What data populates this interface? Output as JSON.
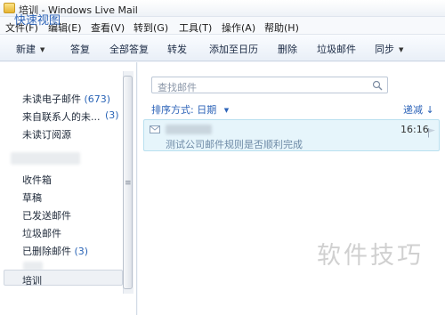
{
  "window": {
    "title": "培训 - Windows Live Mail"
  },
  "menu": [
    "文件(F)",
    "编辑(E)",
    "查看(V)",
    "转到(G)",
    "工具(T)",
    "操作(A)",
    "帮助(H)"
  ],
  "toolbar": {
    "new": "新建",
    "reply": "答复",
    "reply_all": "全部答复",
    "forward": "转发",
    "add_calendar": "添加至日历",
    "delete": "删除",
    "junk": "垃圾邮件",
    "sync": "同步"
  },
  "left_pane": {
    "quick_views_title": "快速视图",
    "unread_email": "未读电子邮件",
    "unread_email_count": "(673)",
    "unread_contacts": "来自联系人的未...",
    "unread_contacts_count": "(3)",
    "unread_feeds": "未读订阅源",
    "folders": {
      "inbox": "收件箱",
      "drafts": "草稿",
      "sent": "已发送邮件",
      "junk": "垃圾邮件",
      "deleted": "已删除邮件",
      "deleted_count": "(3)"
    },
    "bottom_folder": "培训"
  },
  "message_list": {
    "search_placeholder": "查找邮件",
    "sort_label": "排序方式: 日期",
    "sort_direction": "递减",
    "messages": [
      {
        "time": "16:16",
        "subject": "测试公司邮件规则是否顺利完成"
      }
    ]
  },
  "watermark": "软件技巧"
}
